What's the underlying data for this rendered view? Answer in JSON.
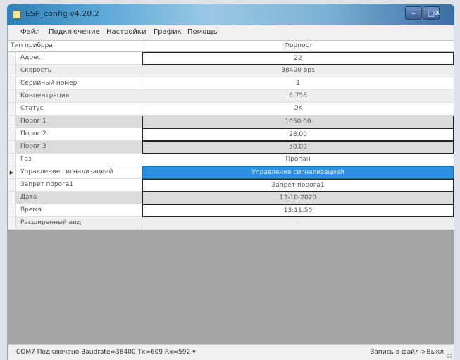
{
  "window": {
    "title": "ESP_config v4.20.2",
    "buttons": {
      "minimize": "–",
      "maximize": "□",
      "close": "x"
    }
  },
  "menu": {
    "items": [
      "Файл",
      "Подключение",
      "Настройки",
      "График",
      "Помощь"
    ]
  },
  "grid": {
    "header": {
      "left": "Тип прибора",
      "right": "Форпост"
    },
    "rows": [
      {
        "label": "Адрес",
        "value": "22"
      },
      {
        "label": "Скорость",
        "value": "38400 bps"
      },
      {
        "label": "Серийный номер",
        "value": "1"
      },
      {
        "label": "Концентрация",
        "value": "6.758"
      },
      {
        "label": "Статус",
        "value": "OK"
      },
      {
        "label": "Порог 1",
        "value": "1050.00"
      },
      {
        "label": "Порог 2",
        "value": "28.00"
      },
      {
        "label": "Порог 3",
        "value": "50.00"
      },
      {
        "label": "Газ",
        "value": "Пропан"
      },
      {
        "label": "Управление сигнализацией",
        "value": "Управление сигнализацией"
      },
      {
        "label": "Запрет порога1",
        "value": "Запрет порога1"
      },
      {
        "label": "Дата",
        "value": "13-10-2020"
      },
      {
        "label": "Время",
        "value": "13:11:50"
      },
      {
        "label": "Расширенный вид",
        "value": "-"
      }
    ],
    "current_row_marker": "▶"
  },
  "statusbar": {
    "left": "COM7 Подключено Baudrate=38400 Tx=609 Rx=592 ▾",
    "right": "Запись в файл->Выкл"
  },
  "colors": {
    "selected": "#2f8fe0",
    "title_gradient_start": "#2e7fb6",
    "grid_background": "#a5a5a5"
  }
}
